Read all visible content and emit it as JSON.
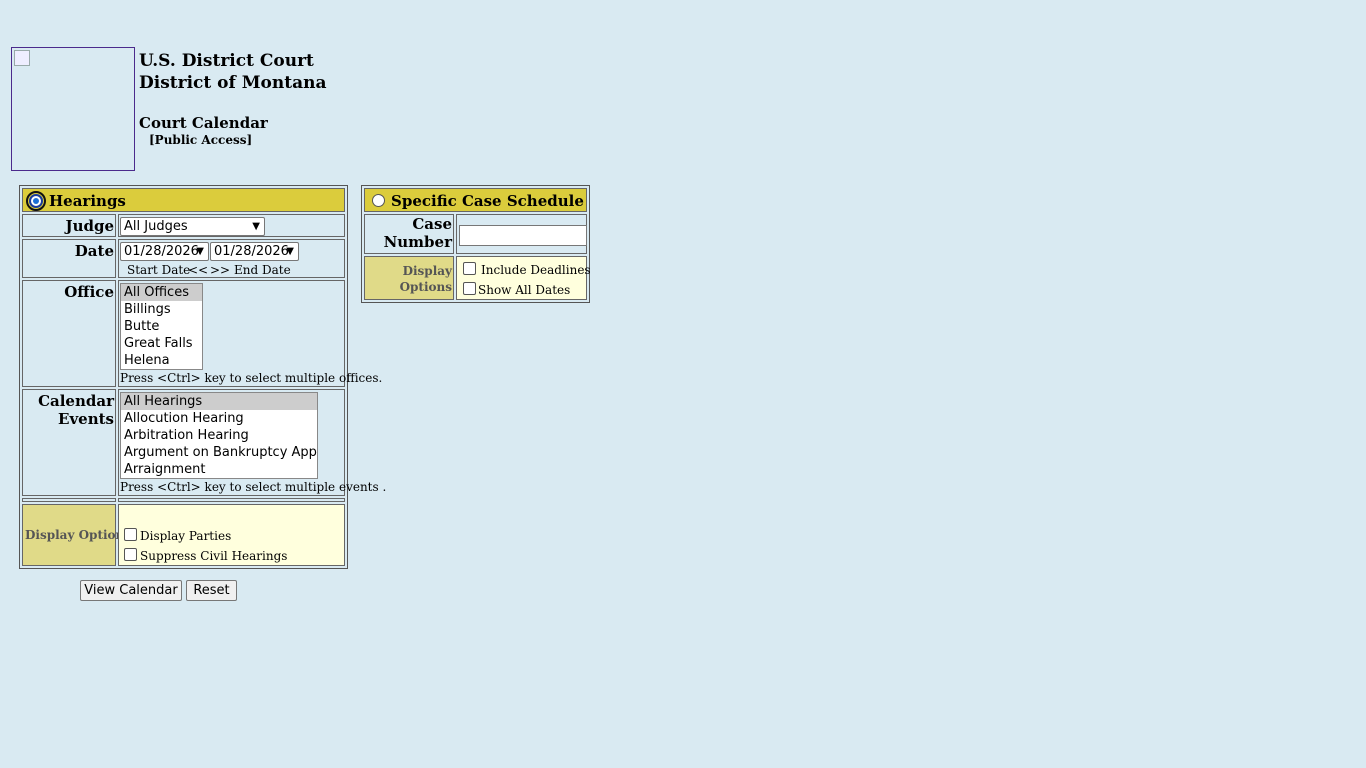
{
  "header": {
    "court_line1": "U.S. District Court",
    "court_line2": "District of Montana",
    "calendar_title": "Court Calendar",
    "access_label": "[Public Access]"
  },
  "hearings": {
    "title": "Hearings",
    "selected": true,
    "judge_label": "Judge",
    "judge_value": "All Judges",
    "date_label": "Date",
    "start_date": "01/28/2026",
    "end_date": "01/28/2026",
    "start_label": "Start Date",
    "prev_symbol": "<<",
    "next_symbol": ">>",
    "end_label": "End Date",
    "office_label": "Office",
    "offices": [
      "All Offices",
      "Billings",
      "Butte",
      "Great Falls",
      "Helena"
    ],
    "office_hint": "Press <Ctrl> key to select multiple offices.",
    "events_label_1": "Calendar",
    "events_label_2": "Events",
    "events": [
      "All Hearings",
      "Allocution Hearing",
      "Arbitration Hearing",
      "Argument on Bankruptcy Appeal",
      "Arraignment"
    ],
    "events_hint": "Press <Ctrl> key to select multiple events .",
    "display_options_label": "Display Options",
    "display_parties": "Display Parties",
    "suppress_civil": "Suppress Civil Hearings"
  },
  "case_schedule": {
    "title": "Specific Case Schedule",
    "selected": false,
    "case_label_1": "Case",
    "case_label_2": "Number",
    "case_number_value": "",
    "display_label_1": "Display",
    "display_label_2": "Options",
    "include_deadlines": "Include Deadlines",
    "show_all_dates": "Show All Dates"
  },
  "buttons": {
    "view_calendar": "View Calendar",
    "reset": "Reset"
  },
  "colors": {
    "background": "#d9eaf2",
    "header_bar": "#dbcc3c",
    "options_label_bg": "#e0da88",
    "options_value_bg": "#ffffdd"
  }
}
